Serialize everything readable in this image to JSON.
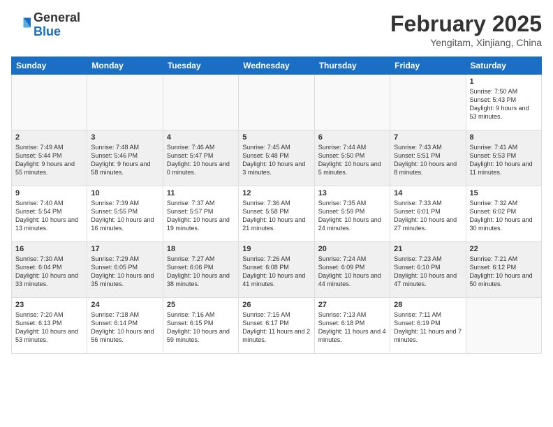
{
  "header": {
    "logo_general": "General",
    "logo_blue": "Blue",
    "month_title": "February 2025",
    "location": "Yengitam, Xinjiang, China"
  },
  "weekdays": [
    "Sunday",
    "Monday",
    "Tuesday",
    "Wednesday",
    "Thursday",
    "Friday",
    "Saturday"
  ],
  "weeks": [
    [
      {
        "day": "",
        "info": ""
      },
      {
        "day": "",
        "info": ""
      },
      {
        "day": "",
        "info": ""
      },
      {
        "day": "",
        "info": ""
      },
      {
        "day": "",
        "info": ""
      },
      {
        "day": "",
        "info": ""
      },
      {
        "day": "1",
        "info": "Sunrise: 7:50 AM\nSunset: 5:43 PM\nDaylight: 9 hours and 53 minutes."
      }
    ],
    [
      {
        "day": "2",
        "info": "Sunrise: 7:49 AM\nSunset: 5:44 PM\nDaylight: 9 hours and 55 minutes."
      },
      {
        "day": "3",
        "info": "Sunrise: 7:48 AM\nSunset: 5:46 PM\nDaylight: 9 hours and 58 minutes."
      },
      {
        "day": "4",
        "info": "Sunrise: 7:46 AM\nSunset: 5:47 PM\nDaylight: 10 hours and 0 minutes."
      },
      {
        "day": "5",
        "info": "Sunrise: 7:45 AM\nSunset: 5:48 PM\nDaylight: 10 hours and 3 minutes."
      },
      {
        "day": "6",
        "info": "Sunrise: 7:44 AM\nSunset: 5:50 PM\nDaylight: 10 hours and 5 minutes."
      },
      {
        "day": "7",
        "info": "Sunrise: 7:43 AM\nSunset: 5:51 PM\nDaylight: 10 hours and 8 minutes."
      },
      {
        "day": "8",
        "info": "Sunrise: 7:41 AM\nSunset: 5:53 PM\nDaylight: 10 hours and 11 minutes."
      }
    ],
    [
      {
        "day": "9",
        "info": "Sunrise: 7:40 AM\nSunset: 5:54 PM\nDaylight: 10 hours and 13 minutes."
      },
      {
        "day": "10",
        "info": "Sunrise: 7:39 AM\nSunset: 5:55 PM\nDaylight: 10 hours and 16 minutes."
      },
      {
        "day": "11",
        "info": "Sunrise: 7:37 AM\nSunset: 5:57 PM\nDaylight: 10 hours and 19 minutes."
      },
      {
        "day": "12",
        "info": "Sunrise: 7:36 AM\nSunset: 5:58 PM\nDaylight: 10 hours and 21 minutes."
      },
      {
        "day": "13",
        "info": "Sunrise: 7:35 AM\nSunset: 5:59 PM\nDaylight: 10 hours and 24 minutes."
      },
      {
        "day": "14",
        "info": "Sunrise: 7:33 AM\nSunset: 6:01 PM\nDaylight: 10 hours and 27 minutes."
      },
      {
        "day": "15",
        "info": "Sunrise: 7:32 AM\nSunset: 6:02 PM\nDaylight: 10 hours and 30 minutes."
      }
    ],
    [
      {
        "day": "16",
        "info": "Sunrise: 7:30 AM\nSunset: 6:04 PM\nDaylight: 10 hours and 33 minutes."
      },
      {
        "day": "17",
        "info": "Sunrise: 7:29 AM\nSunset: 6:05 PM\nDaylight: 10 hours and 35 minutes."
      },
      {
        "day": "18",
        "info": "Sunrise: 7:27 AM\nSunset: 6:06 PM\nDaylight: 10 hours and 38 minutes."
      },
      {
        "day": "19",
        "info": "Sunrise: 7:26 AM\nSunset: 6:08 PM\nDaylight: 10 hours and 41 minutes."
      },
      {
        "day": "20",
        "info": "Sunrise: 7:24 AM\nSunset: 6:09 PM\nDaylight: 10 hours and 44 minutes."
      },
      {
        "day": "21",
        "info": "Sunrise: 7:23 AM\nSunset: 6:10 PM\nDaylight: 10 hours and 47 minutes."
      },
      {
        "day": "22",
        "info": "Sunrise: 7:21 AM\nSunset: 6:12 PM\nDaylight: 10 hours and 50 minutes."
      }
    ],
    [
      {
        "day": "23",
        "info": "Sunrise: 7:20 AM\nSunset: 6:13 PM\nDaylight: 10 hours and 53 minutes."
      },
      {
        "day": "24",
        "info": "Sunrise: 7:18 AM\nSunset: 6:14 PM\nDaylight: 10 hours and 56 minutes."
      },
      {
        "day": "25",
        "info": "Sunrise: 7:16 AM\nSunset: 6:15 PM\nDaylight: 10 hours and 59 minutes."
      },
      {
        "day": "26",
        "info": "Sunrise: 7:15 AM\nSunset: 6:17 PM\nDaylight: 11 hours and 2 minutes."
      },
      {
        "day": "27",
        "info": "Sunrise: 7:13 AM\nSunset: 6:18 PM\nDaylight: 11 hours and 4 minutes."
      },
      {
        "day": "28",
        "info": "Sunrise: 7:11 AM\nSunset: 6:19 PM\nDaylight: 11 hours and 7 minutes."
      },
      {
        "day": "",
        "info": ""
      }
    ]
  ]
}
